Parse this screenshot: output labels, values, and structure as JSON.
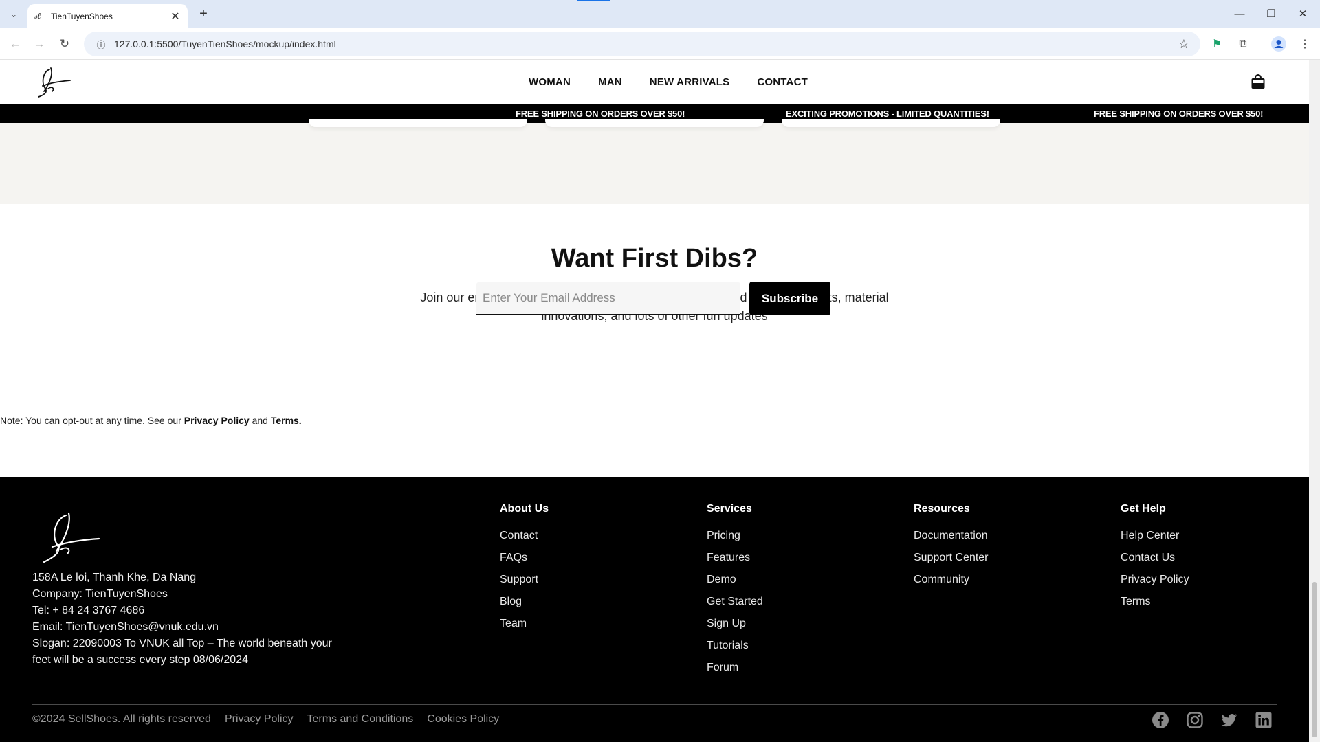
{
  "browser": {
    "tab_title": "TienTuyenShoes",
    "url": "127.0.0.1:5500/TuyenTienShoes/mockup/index.html"
  },
  "header": {
    "nav": [
      "WOMAN",
      "MAN",
      "NEW ARRIVALS",
      "CONTACT"
    ]
  },
  "promo": [
    "FREE SHIPPING ON ORDERS OVER $50!",
    "EXCITING PROMOTIONS - LIMITED QUANTITIES!",
    "FREE SHIPPING ON ORDERS OVER $50!"
  ],
  "newsletter": {
    "title": "Want First Dibs?",
    "description": "Join our email list and be the first to know about new limited edition products, material innovations, and lots of other fun updates",
    "email_placeholder": "Enter Your Email Address",
    "subscribe_label": "Subscribe",
    "note_prefix": "Note: You can opt-out at any time. See our",
    "privacy_label": "Privacy Policy",
    "note_and": "and",
    "terms_label": "Terms."
  },
  "footer": {
    "info": [
      "158A Le loi, Thanh Khe, Da Nang",
      "Company: TienTuyenShoes",
      "Tel: + 84 24 3767 4686",
      "Email: TienTuyenShoes@vnuk.edu.vn",
      "Slogan: 22090003 To VNUK all Top – The world beneath your feet will be a success every step 08/06/2024"
    ],
    "columns": [
      {
        "title": "About Us",
        "links": [
          "Contact",
          "FAQs",
          "Support",
          "Blog",
          "Team"
        ]
      },
      {
        "title": "Services",
        "links": [
          "Pricing",
          "Features",
          "Demo",
          "Get Started",
          "Sign Up",
          "Tutorials",
          "Forum"
        ]
      },
      {
        "title": "Resources",
        "links": [
          "Documentation",
          "Support Center",
          "Community"
        ]
      },
      {
        "title": "Get Help",
        "links": [
          "Help Center",
          "Contact Us",
          "Privacy Policy",
          "Terms"
        ]
      }
    ],
    "copyright": "©2024 SellShoes. All rights reserved",
    "legal_links": [
      "Privacy Policy",
      "Terms and Conditions",
      "Cookies Policy"
    ],
    "social": [
      "facebook-icon",
      "instagram-icon",
      "twitter-icon",
      "linkedin-icon"
    ]
  }
}
